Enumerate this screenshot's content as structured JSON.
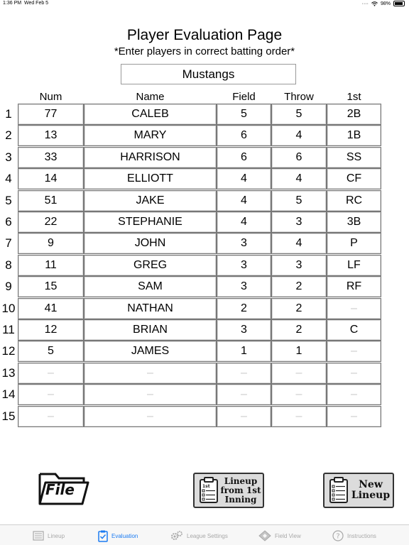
{
  "status_bar": {
    "time": "1:36 PM",
    "date": "Wed Feb 5",
    "battery_percent": "98%",
    "icons": [
      "dots-icon",
      "wifi-icon",
      "battery-icon"
    ]
  },
  "header": {
    "title": "Player Evaluation Page",
    "subtitle": "*Enter players in correct batting order*",
    "team_name": "Mustangs"
  },
  "table": {
    "columns": [
      "Num",
      "Name",
      "Field",
      "Throw",
      "1st"
    ],
    "rows": [
      {
        "order": "1",
        "num": "77",
        "name": "CALEB",
        "field": "5",
        "throw": "5",
        "first": "2B"
      },
      {
        "order": "2",
        "num": "13",
        "name": "MARY",
        "field": "6",
        "throw": "4",
        "first": "1B"
      },
      {
        "order": "3",
        "num": "33",
        "name": "HARRISON",
        "field": "6",
        "throw": "6",
        "first": "SS"
      },
      {
        "order": "4",
        "num": "14",
        "name": "ELLIOTT",
        "field": "4",
        "throw": "4",
        "first": "CF"
      },
      {
        "order": "5",
        "num": "51",
        "name": "JAKE",
        "field": "4",
        "throw": "5",
        "first": "RC"
      },
      {
        "order": "6",
        "num": "22",
        "name": "STEPHANIE",
        "field": "4",
        "throw": "3",
        "first": "3B"
      },
      {
        "order": "7",
        "num": "9",
        "name": "JOHN",
        "field": "3",
        "throw": "4",
        "first": "P"
      },
      {
        "order": "8",
        "num": "11",
        "name": "GREG",
        "field": "3",
        "throw": "3",
        "first": "LF"
      },
      {
        "order": "9",
        "num": "15",
        "name": "SAM",
        "field": "3",
        "throw": "2",
        "first": "RF"
      },
      {
        "order": "10",
        "num": "41",
        "name": "NATHAN",
        "field": "2",
        "throw": "2",
        "first": "–"
      },
      {
        "order": "11",
        "num": "12",
        "name": "BRIAN",
        "field": "3",
        "throw": "2",
        "first": "C"
      },
      {
        "order": "12",
        "num": "5",
        "name": "JAMES",
        "field": "1",
        "throw": "1",
        "first": "–"
      },
      {
        "order": "13",
        "num": "–",
        "name": "–",
        "field": "–",
        "throw": "–",
        "first": "–"
      },
      {
        "order": "14",
        "num": "–",
        "name": "–",
        "field": "–",
        "throw": "–",
        "first": "–"
      },
      {
        "order": "15",
        "num": "–",
        "name": "–",
        "field": "–",
        "throw": "–",
        "first": "–"
      }
    ]
  },
  "actions": {
    "file_label": "File",
    "lineup_label_lines": [
      "Lineup",
      "from 1st",
      "Inning"
    ],
    "new_label_lines": [
      "New",
      "Lineup"
    ]
  },
  "tabs": [
    {
      "label": "Lineup",
      "icon": "lineup-icon",
      "active": false
    },
    {
      "label": "Evaluation",
      "icon": "clipboard-check-icon",
      "active": true
    },
    {
      "label": "League Settings",
      "icon": "gears-icon",
      "active": false
    },
    {
      "label": "Field View",
      "icon": "diamond-icon",
      "active": false
    },
    {
      "label": "Instructions",
      "icon": "question-icon",
      "active": false
    }
  ],
  "colors": {
    "accent": "#1c7cf2",
    "inactive_tab": "#a8a8a8",
    "cell_border": "#777777",
    "placeholder": "#c8c8c8",
    "button_bg": "#dcdcdc"
  }
}
